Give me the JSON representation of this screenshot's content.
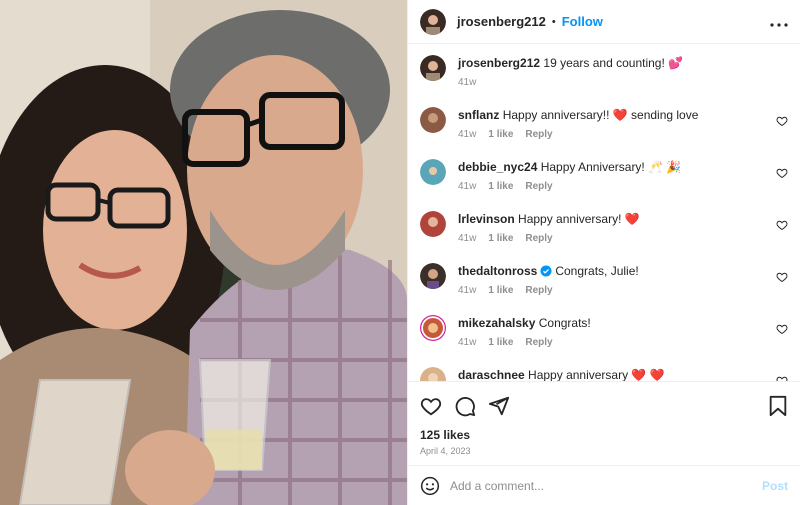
{
  "post": {
    "author": "jrosenberg212",
    "follow_label": "Follow",
    "separator": "•",
    "more_label": "•••",
    "photo_alt": "Selfie of a couple holding champagne glasses"
  },
  "caption": {
    "username": "jrosenberg212",
    "text": "19 years and counting! 💕",
    "age": "41w"
  },
  "comments": [
    {
      "username": "snflanz",
      "text": "Happy anniversary!! ❤️ sending love",
      "age": "41w",
      "likes": "1 like",
      "reply": "Reply",
      "verified": false,
      "avatar_color": "#8a5a44"
    },
    {
      "username": "debbie_nyc24",
      "text": "Happy Anniversary! 🥂 🎉",
      "age": "41w",
      "likes": "1 like",
      "reply": "Reply",
      "verified": false,
      "avatar_color": "#5aa6b8"
    },
    {
      "username": "lrlevinson",
      "text": "Happy anniversary! ❤️",
      "age": "41w",
      "likes": "1 like",
      "reply": "Reply",
      "verified": false,
      "avatar_color": "#b0443a"
    },
    {
      "username": "thedaltonross",
      "text": "Congrats, Julie!",
      "age": "41w",
      "likes": "1 like",
      "reply": "Reply",
      "verified": true,
      "avatar_color": "#3b2f2a"
    },
    {
      "username": "mikezahalsky",
      "text": "Congrats!",
      "age": "41w",
      "likes": "1 like",
      "reply": "Reply",
      "verified": false,
      "avatar_color": "#c5593a"
    },
    {
      "username": "daraschnee",
      "text": "Happy anniversary ❤️ ❤️",
      "age": "",
      "likes": "",
      "reply": "",
      "verified": false,
      "avatar_color": "#d8b28a"
    }
  ],
  "stats": {
    "likes": "125 likes",
    "date": "April 4, 2023"
  },
  "composer": {
    "placeholder": "Add a comment...",
    "post_label": "Post"
  },
  "icons": {
    "like": "heart-icon",
    "comment": "comment-icon",
    "share": "share-icon",
    "save": "bookmark-icon",
    "emoji": "emoji-icon"
  },
  "colors": {
    "accent": "#0095f6",
    "muted": "#8e8e8e",
    "heart": "#ed4956",
    "post_disabled": "#b2dffc"
  }
}
